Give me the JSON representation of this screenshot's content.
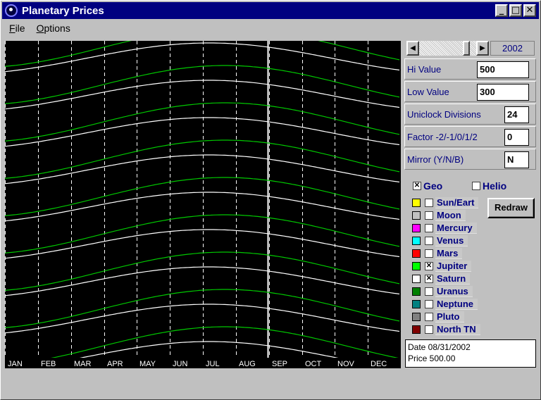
{
  "window": {
    "title": "Planetary Prices"
  },
  "title_buttons": {
    "minimize": "_",
    "maximize": "□",
    "close": "✕"
  },
  "menu": {
    "file": "File",
    "options": "Options"
  },
  "year": "2002",
  "fields": {
    "hi_value": {
      "label": "Hi Value",
      "value": "500"
    },
    "low_value": {
      "label": "Low Value",
      "value": "300"
    },
    "uniclock": {
      "label": "Uniclock Divisions",
      "value": "24"
    },
    "factor": {
      "label": "Factor -2/-1/0/1/2",
      "value": "0"
    },
    "mirror": {
      "label": "Mirror (Y/N/B)",
      "value": "N"
    }
  },
  "geo": {
    "label": "Geo",
    "checked": true
  },
  "helio": {
    "label": "Helio",
    "checked": false
  },
  "planets": [
    {
      "label": "Sun/Eart",
      "color": "#ffff00",
      "checked": false
    },
    {
      "label": "Moon",
      "color": "#c0c0c0",
      "checked": false
    },
    {
      "label": "Mercury",
      "color": "#ff00ff",
      "checked": false
    },
    {
      "label": "Venus",
      "color": "#00ffff",
      "checked": false
    },
    {
      "label": "Mars",
      "color": "#ff0000",
      "checked": false
    },
    {
      "label": "Jupiter",
      "color": "#00ff00",
      "checked": true
    },
    {
      "label": "Saturn",
      "color": "#ffffff",
      "checked": true
    },
    {
      "label": "Uranus",
      "color": "#008000",
      "checked": false
    },
    {
      "label": "Neptune",
      "color": "#008080",
      "checked": false
    },
    {
      "label": "Pluto",
      "color": "#808080",
      "checked": false
    },
    {
      "label": "North TN",
      "color": "#800000",
      "checked": false
    }
  ],
  "redraw_label": "Redraw",
  "info": {
    "date": "Date 08/31/2002",
    "price": "Price 500.00"
  },
  "months": [
    "JAN",
    "FEB",
    "MAR",
    "APR",
    "MAY",
    "JUN",
    "JUL",
    "AUG",
    "SEP",
    "OCT",
    "NOV",
    "DEC"
  ],
  "colors": {
    "jupiter_line": "#00c800",
    "saturn_line": "#ffffff",
    "grid": "#ffffff"
  }
}
